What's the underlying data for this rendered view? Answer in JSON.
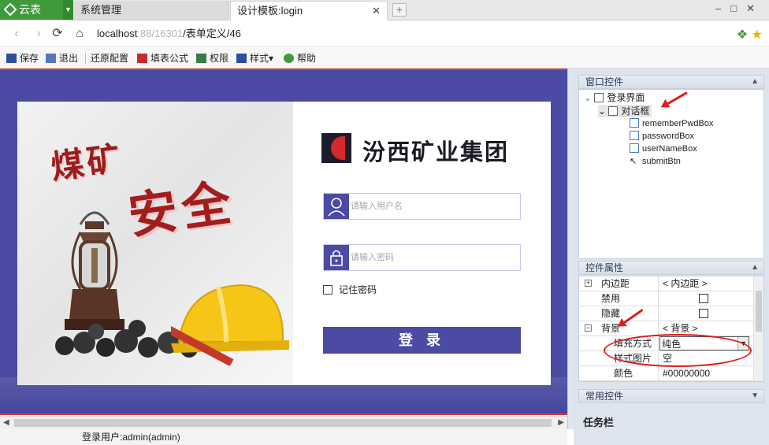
{
  "browser": {
    "brand_tab": "云表",
    "tabs": [
      {
        "label": "系统管理"
      },
      {
        "label": "设计模板:login"
      }
    ],
    "url_main": "localhost",
    "url_dim": ":88/16301",
    "url_tail": "/表单定义/46"
  },
  "toolbar": {
    "items": [
      {
        "label": "保存"
      },
      {
        "label": "退出"
      },
      {
        "label": "还原配置"
      },
      {
        "label": "填表公式"
      },
      {
        "label": "权限"
      },
      {
        "label": "样式▾"
      },
      {
        "label": "帮助"
      }
    ]
  },
  "login_form": {
    "poster_title_1": "煤矿",
    "poster_title_2": "安全",
    "company_name": "汾西矿业集团",
    "username_placeholder": "请输入用户名",
    "password_placeholder": "请输入密码",
    "remember_label": "记住密码",
    "login_button": "登 录"
  },
  "status": {
    "login_user": "登录用户:admin(admin)"
  },
  "window_controls_panel": {
    "title": "窗口控件",
    "tree": [
      {
        "label": "登录界面"
      },
      {
        "label": "对话框"
      },
      {
        "label": "rememberPwdBox"
      },
      {
        "label": "passwordBox"
      },
      {
        "label": "userNameBox"
      },
      {
        "label": "submitBtn"
      }
    ]
  },
  "control_props_panel": {
    "title": "控件属性",
    "rows": [
      {
        "name": "内边距",
        "value": "< 内边距 >"
      },
      {
        "name": "禁用",
        "value": ""
      },
      {
        "name": "隐藏",
        "value": ""
      },
      {
        "name": "背景",
        "value": "< 背景 >"
      },
      {
        "name": "填充方式",
        "value": "纯色"
      },
      {
        "name": "样式图片",
        "value": "空"
      },
      {
        "name": "颜色",
        "value": "#00000000"
      }
    ]
  },
  "common_controls_panel": {
    "title": "常用控件"
  },
  "taskbar": {
    "label": "任务栏"
  },
  "colors": {
    "brand_green": "#3e9a3a",
    "canvas_blue": "#4b4ba3",
    "annotation_red": "#e01b1b"
  }
}
